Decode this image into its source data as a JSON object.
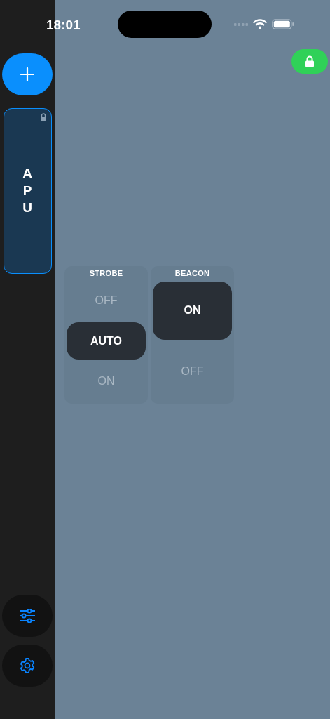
{
  "status_bar": {
    "time": "18:01"
  },
  "sidebar": {
    "cards": [
      {
        "label": "APU",
        "locked": true,
        "selected": true
      }
    ]
  },
  "lock_button": {
    "locked": true
  },
  "switches": [
    {
      "title": "STROBE",
      "options": [
        {
          "label": "OFF",
          "selected": false
        },
        {
          "label": "AUTO",
          "selected": true
        },
        {
          "label": "ON",
          "selected": false
        }
      ]
    },
    {
      "title": "BEACON",
      "options": [
        {
          "label": "ON",
          "selected": true
        },
        {
          "label": "OFF",
          "selected": false
        }
      ]
    }
  ]
}
